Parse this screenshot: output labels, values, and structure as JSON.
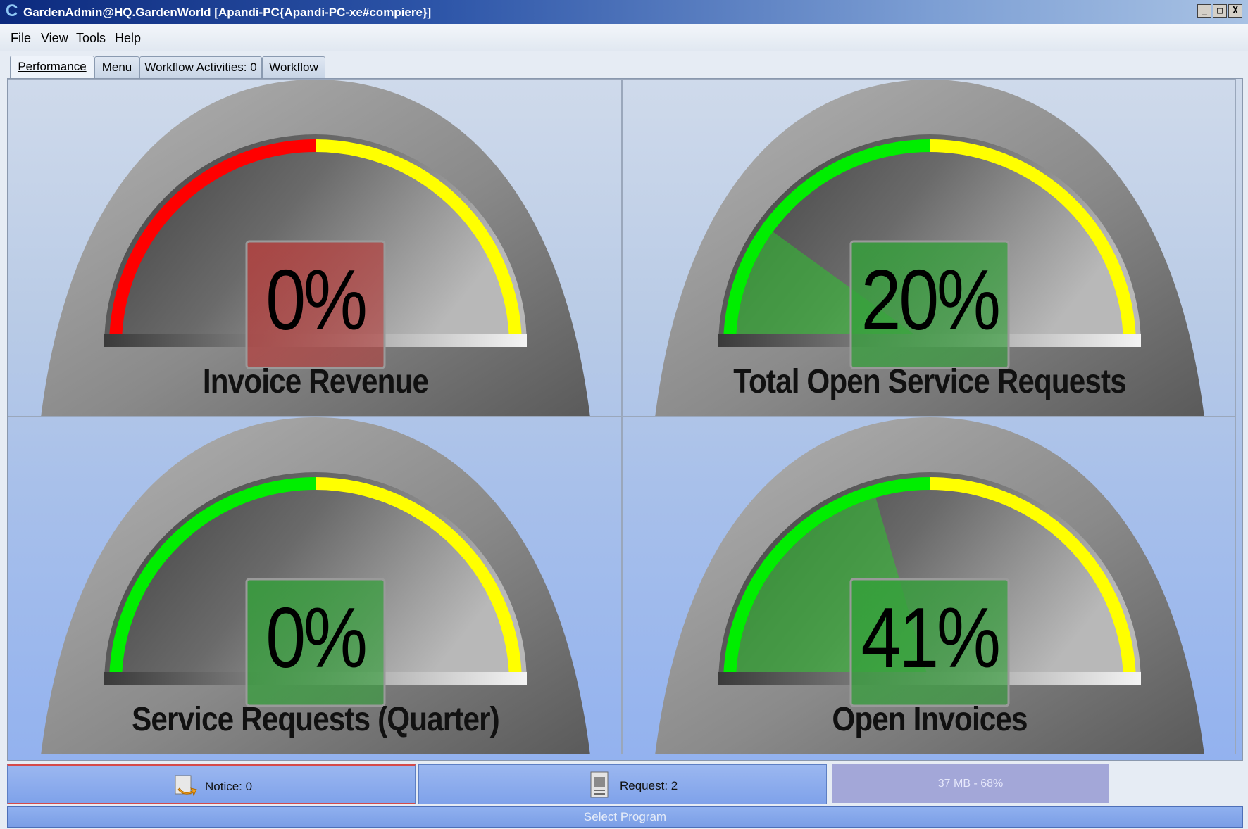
{
  "window": {
    "title": "GardenAdmin@HQ.GardenWorld [Apandi-PC{Apandi-PC-xe#compiere}]",
    "logo_glyph": "C",
    "controls": [
      "_",
      "□",
      "X"
    ]
  },
  "menu": [
    {
      "label": "File"
    },
    {
      "label": "View"
    },
    {
      "label": "Tools"
    },
    {
      "label": "Help"
    }
  ],
  "tabs": [
    {
      "label": "Performance",
      "active": true
    },
    {
      "label": "Menu",
      "active": false
    },
    {
      "label": "Workflow Activities: 0",
      "active": false
    },
    {
      "label": "Workflow",
      "active": false
    }
  ],
  "gauges": [
    {
      "title": "Invoice Revenue",
      "value": "0%",
      "percent": 0,
      "arc": [
        "#ff0000",
        "#ffff00"
      ],
      "box_color": "#b4403e",
      "needle_color": "#ff0000"
    },
    {
      "title": "Total Open Service Requests",
      "value": "20%",
      "percent": 20,
      "arc": [
        "#00ee00",
        "#ffff00"
      ],
      "box_color": "#34a03a",
      "needle_color": "#2ec42e"
    },
    {
      "title": "Service Requests (Quarter)",
      "value": "0%",
      "percent": 0,
      "arc": [
        "#00ee00",
        "#ffff00"
      ],
      "box_color": "#34a03a",
      "needle_color": "#2ec42e"
    },
    {
      "title": "Open Invoices",
      "value": "41%",
      "percent": 41,
      "arc": [
        "#00ee00",
        "#ffff00"
      ],
      "box_color": "#34a03a",
      "needle_color": "#2ec42e"
    }
  ],
  "status": {
    "notice_label": "Notice: 0",
    "notice_icon": "notice-arrow-icon",
    "request_label": "Request: 2",
    "request_icon": "request-document-icon",
    "memory": "37 MB - 68%"
  },
  "footer": {
    "program_label": "Select Program"
  }
}
